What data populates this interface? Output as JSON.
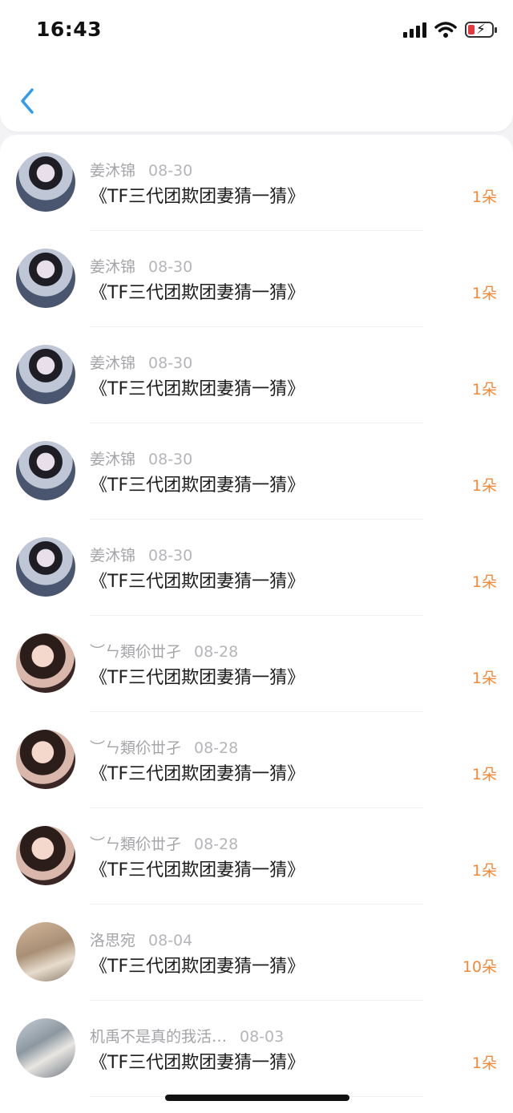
{
  "status": {
    "time": "16:43"
  },
  "items": [
    {
      "name": "姜沐锦",
      "date": "08-30",
      "title": "《TF三代团欺团妻猜一猜》",
      "count": "1朵"
    },
    {
      "name": "姜沐锦",
      "date": "08-30",
      "title": "《TF三代团欺团妻猜一猜》",
      "count": "1朵"
    },
    {
      "name": "姜沐锦",
      "date": "08-30",
      "title": "《TF三代团欺团妻猜一猜》",
      "count": "1朵"
    },
    {
      "name": "姜沐锦",
      "date": "08-30",
      "title": "《TF三代团欺团妻猜一猜》",
      "count": "1朵"
    },
    {
      "name": "姜沐锦",
      "date": "08-30",
      "title": "《TF三代团欺团妻猜一猜》",
      "count": "1朵"
    },
    {
      "name": "︶ㄣ類伱丗孑",
      "date": "08-28",
      "title": "《TF三代团欺团妻猜一猜》",
      "count": "1朵"
    },
    {
      "name": "︶ㄣ類伱丗孑",
      "date": "08-28",
      "title": "《TF三代团欺团妻猜一猜》",
      "count": "1朵"
    },
    {
      "name": "︶ㄣ類伱丗孑",
      "date": "08-28",
      "title": "《TF三代团欺团妻猜一猜》",
      "count": "1朵"
    },
    {
      "name": "洛思宛",
      "date": "08-04",
      "title": "《TF三代团欺团妻猜一猜》",
      "count": "10朵"
    },
    {
      "name": "机禹不是真的我活…",
      "date": "08-03",
      "title": "《TF三代团欺团妻猜一猜》",
      "count": "1朵"
    }
  ],
  "colors": {
    "accent": "#2f9cf0",
    "count": "#ef8a39"
  }
}
